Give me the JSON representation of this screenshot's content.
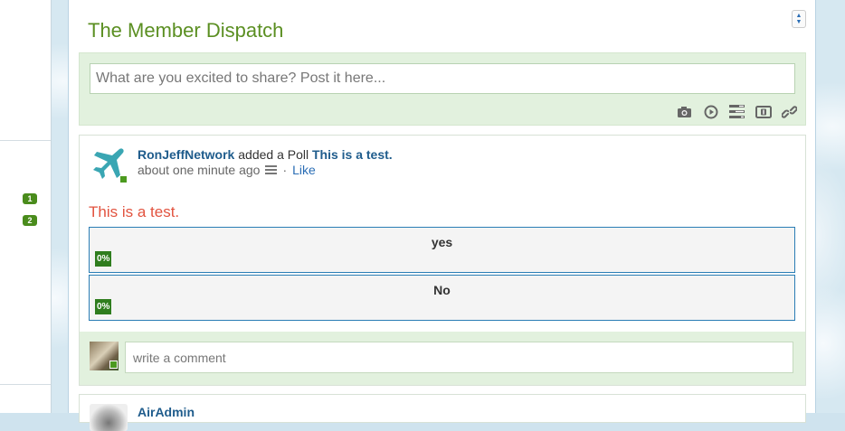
{
  "left_panel": {
    "badges": [
      "1",
      "2"
    ]
  },
  "feed": {
    "title": "The Member Dispatch"
  },
  "share": {
    "placeholder": "What are you excited to share? Post it here...",
    "tools": [
      "camera-icon",
      "video-play-icon",
      "poll-list-icon",
      "currency-icon",
      "link-icon"
    ]
  },
  "post": {
    "author": "RonJeffNetwork",
    "action": "added a Poll",
    "subject": "This is a test.",
    "time": "about one minute ago",
    "separator": "·",
    "like_label": "Like",
    "poll": {
      "question": "This is a test.",
      "options": [
        {
          "label": "yes",
          "percent": "0%"
        },
        {
          "label": "No",
          "percent": "0%"
        }
      ]
    },
    "comment_placeholder": "write a comment"
  },
  "next_post": {
    "author": "AirAdmin"
  },
  "colors": {
    "title_green": "#5b8f22",
    "poll_red": "#e2533f",
    "link_blue": "#1f5c8c",
    "share_bg": "#e2f1de",
    "percent_green": "#2f7d1e"
  }
}
